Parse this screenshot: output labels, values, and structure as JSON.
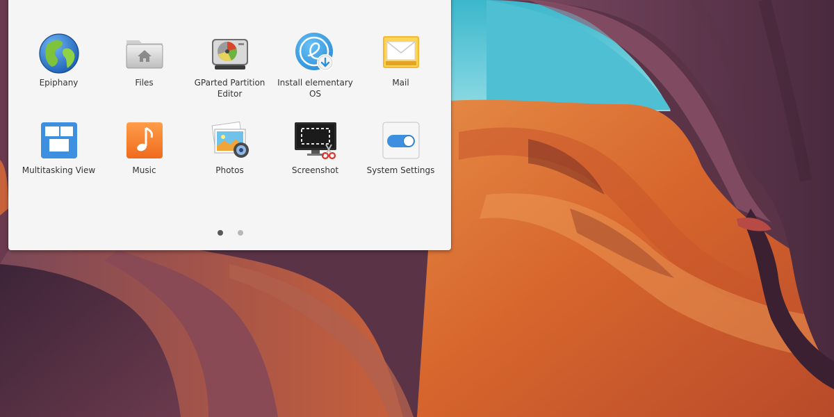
{
  "menu": {
    "cutoff_labels": [
      "",
      "",
      "",
      "",
      ""
    ],
    "apps": [
      {
        "label": "Epiphany",
        "icon": "epiphany-globe-icon"
      },
      {
        "label": "Files",
        "icon": "files-folder-icon"
      },
      {
        "label": "GParted Partition Editor",
        "icon": "gparted-disk-icon"
      },
      {
        "label": "Install elementary OS",
        "icon": "installer-icon"
      },
      {
        "label": "Mail",
        "icon": "mail-envelope-icon"
      },
      {
        "label": "Multitasking View",
        "icon": "multitasking-view-icon"
      },
      {
        "label": "Music",
        "icon": "music-note-icon"
      },
      {
        "label": "Photos",
        "icon": "photos-icon"
      },
      {
        "label": "Screenshot",
        "icon": "screenshot-icon"
      },
      {
        "label": "System Settings",
        "icon": "system-settings-toggle-icon"
      }
    ],
    "pager": {
      "pages": 2,
      "current": 1
    }
  },
  "wallpaper": {
    "sky_color": "#5cc8d8",
    "rock_color": "#d96a2c"
  }
}
